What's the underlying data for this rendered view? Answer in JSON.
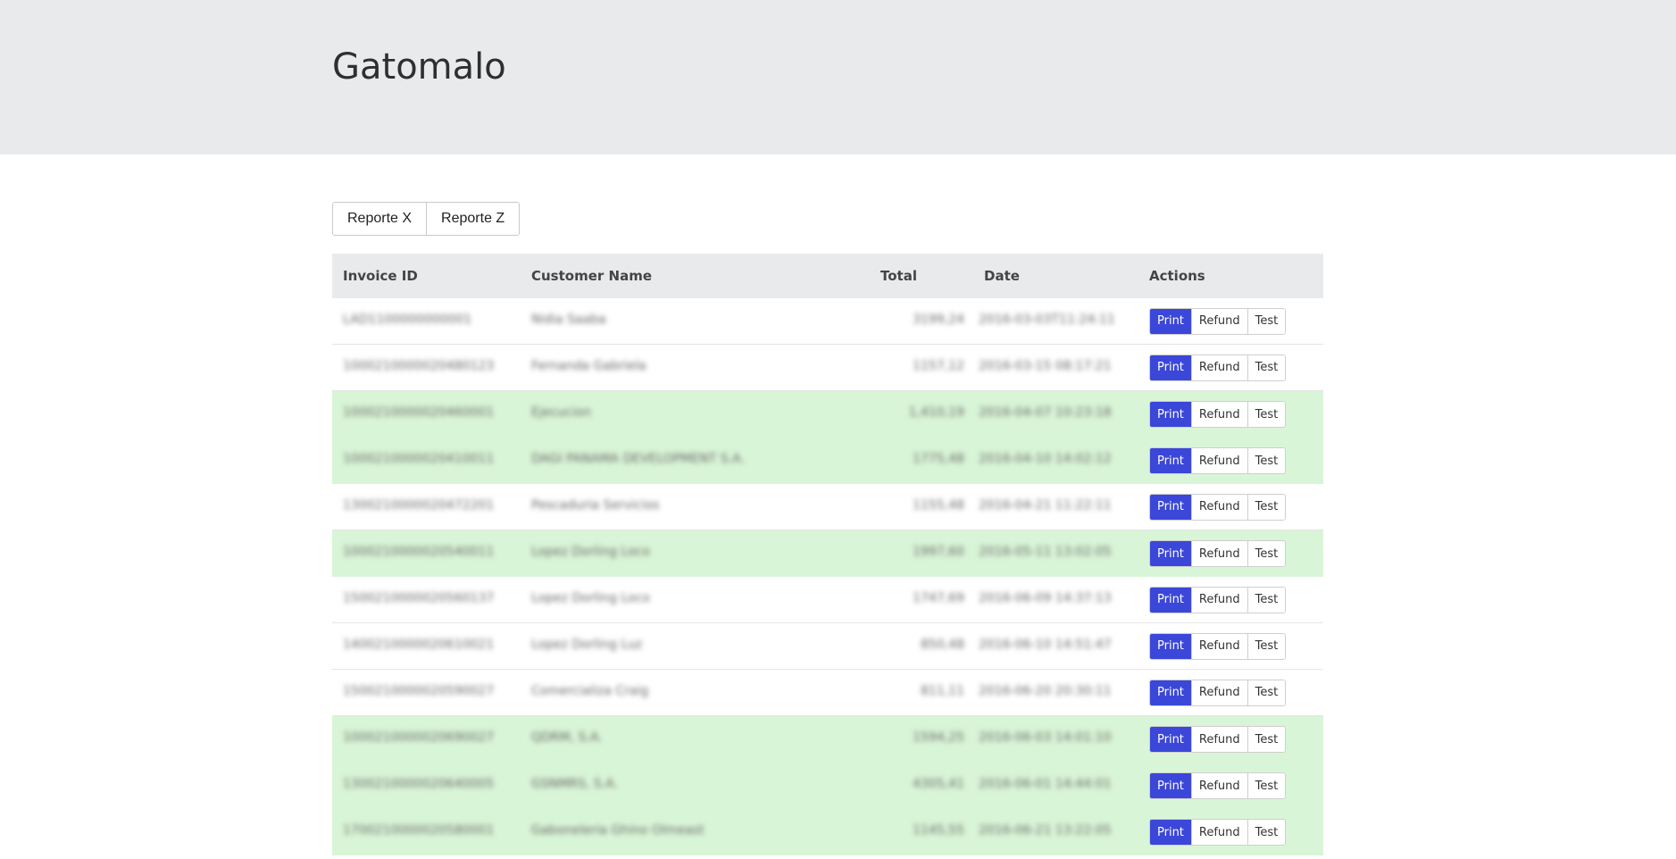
{
  "header": {
    "title": "Gatomalo"
  },
  "reports": {
    "x_label": "Reporte X",
    "z_label": "Reporte Z"
  },
  "table": {
    "columns": [
      "Invoice ID",
      "Customer Name",
      "Total",
      "Date",
      "Actions"
    ],
    "action_labels": {
      "print": "Print",
      "refund": "Refund",
      "test": "Test"
    },
    "rows": [
      {
        "green": false,
        "id": "LAD1100000000001",
        "name": "Nidia Saaba",
        "total": "3199,24",
        "date": "2016-03-03T11:24:11"
      },
      {
        "green": false,
        "id": "1000210000020480123",
        "name": "Fernanda Gabriela",
        "total": "1157,12",
        "date": "2016-03-15 08:17:21"
      },
      {
        "green": true,
        "id": "1000210000020460001",
        "name": "Ejecucion",
        "total": "1,410,19",
        "date": "2016-04-07 10:23:18"
      },
      {
        "green": true,
        "id": "1000210000020410011",
        "name": "DAGI PANAMA DEVELOPMENT S.A.",
        "total": "1775,48",
        "date": "2016-04-10 14:02:12"
      },
      {
        "green": false,
        "id": "1300210000020472201",
        "name": "Pescaduria Servicios",
        "total": "1155,48",
        "date": "2016-04-21 11:22:11"
      },
      {
        "green": true,
        "id": "1000210000020540011",
        "name": "Lopez Dorling Loco",
        "total": "1997,60",
        "date": "2016-05-11 13:02:05"
      },
      {
        "green": false,
        "id": "1500210000020560137",
        "name": "Lopez Dorling Loco",
        "total": "1747,69",
        "date": "2016-06-09 14:37:13"
      },
      {
        "green": false,
        "id": "1400210000020610021",
        "name": "Lopez Dorling Luz",
        "total": "850,48",
        "date": "2016-06-10 14:51:47"
      },
      {
        "green": false,
        "id": "1500210000020590027",
        "name": "Comercializa Craig",
        "total": "811,11",
        "date": "2016-06-20 20:30:11"
      },
      {
        "green": true,
        "id": "1000210000020690027",
        "name": "QDRM, S.A.",
        "total": "1594,25",
        "date": "2016-06-03 14:01:10"
      },
      {
        "green": true,
        "id": "1300210000020640005",
        "name": "GSNMRS, S.A.",
        "total": "4305,41",
        "date": "2016-06-01 14:44:01"
      },
      {
        "green": true,
        "id": "1700210000020580001",
        "name": "Gaboneleria Ghino Olmeast",
        "total": "1145,55",
        "date": "2016-06-21 13:22:05"
      }
    ]
  }
}
